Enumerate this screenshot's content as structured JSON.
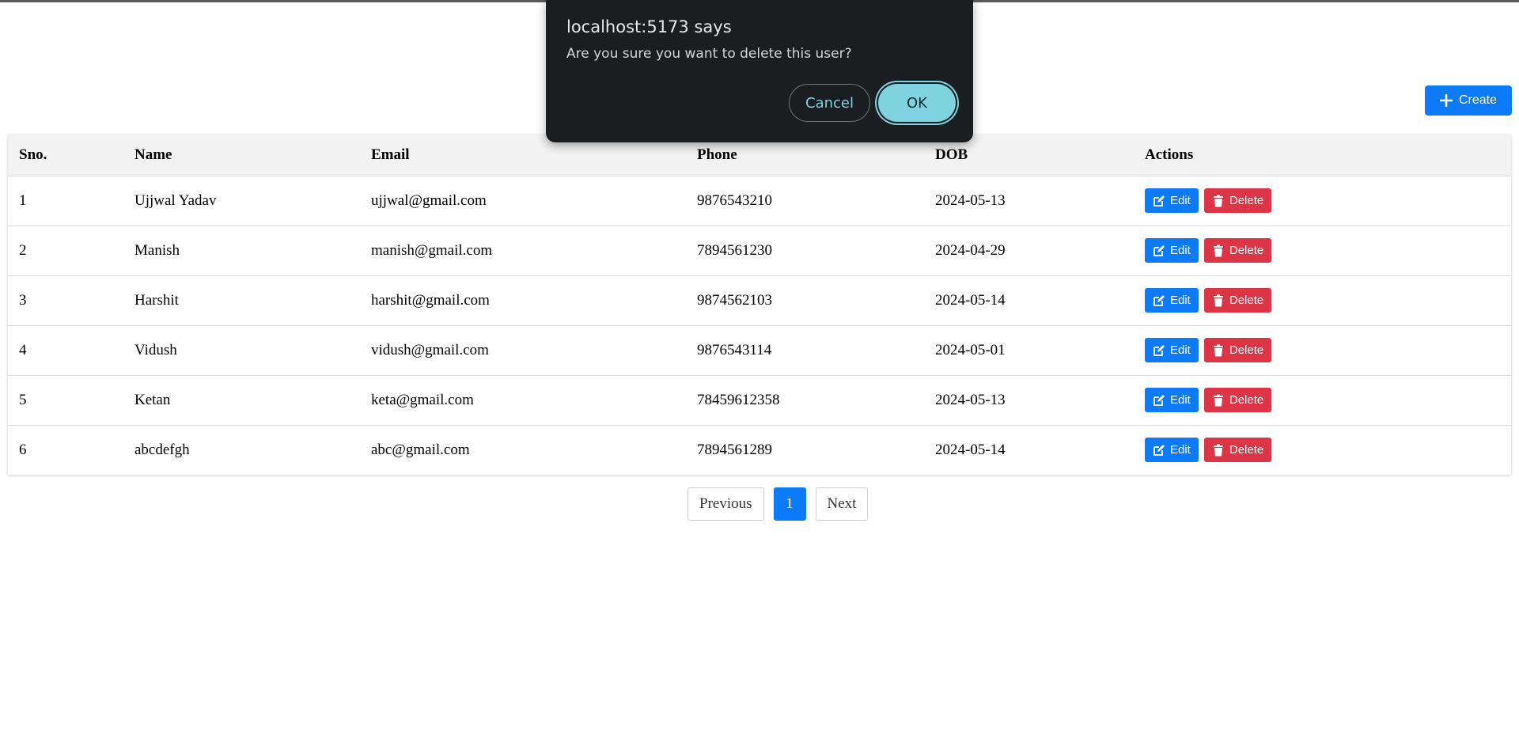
{
  "header": {
    "create_label": "Create",
    "create_icon": "plus-icon",
    "accent_color": "#0d7bf7"
  },
  "table": {
    "columns": [
      "Sno.",
      "Name",
      "Email",
      "Phone",
      "DOB",
      "Actions"
    ],
    "rows": [
      {
        "sno": "1",
        "name": "Ujjwal Yadav",
        "email": "ujjwal@gmail.com",
        "phone": "9876543210",
        "dob": "2024-05-13"
      },
      {
        "sno": "2",
        "name": "Manish",
        "email": "manish@gmail.com",
        "phone": "7894561230",
        "dob": "2024-04-29"
      },
      {
        "sno": "3",
        "name": "Harshit",
        "email": "harshit@gmail.com",
        "phone": "9874562103",
        "dob": "2024-05-14"
      },
      {
        "sno": "4",
        "name": "Vidush",
        "email": "vidush@gmail.com",
        "phone": "9876543114",
        "dob": "2024-05-01"
      },
      {
        "sno": "5",
        "name": "Ketan",
        "email": "keta@gmail.com",
        "phone": "78459612358",
        "dob": "2024-05-13"
      },
      {
        "sno": "6",
        "name": "abcdefgh",
        "email": "abc@gmail.com",
        "phone": "7894561289",
        "dob": "2024-05-14"
      }
    ],
    "edit_label": "Edit",
    "delete_label": "Delete",
    "edit_color": "#0d7bf7",
    "delete_color": "#dc3545"
  },
  "pagination": {
    "previous_label": "Previous",
    "current_page": "1",
    "next_label": "Next"
  },
  "dialog": {
    "title": "localhost:5173 says",
    "message": "Are you sure you want to delete this user?",
    "cancel_label": "Cancel",
    "ok_label": "OK"
  }
}
